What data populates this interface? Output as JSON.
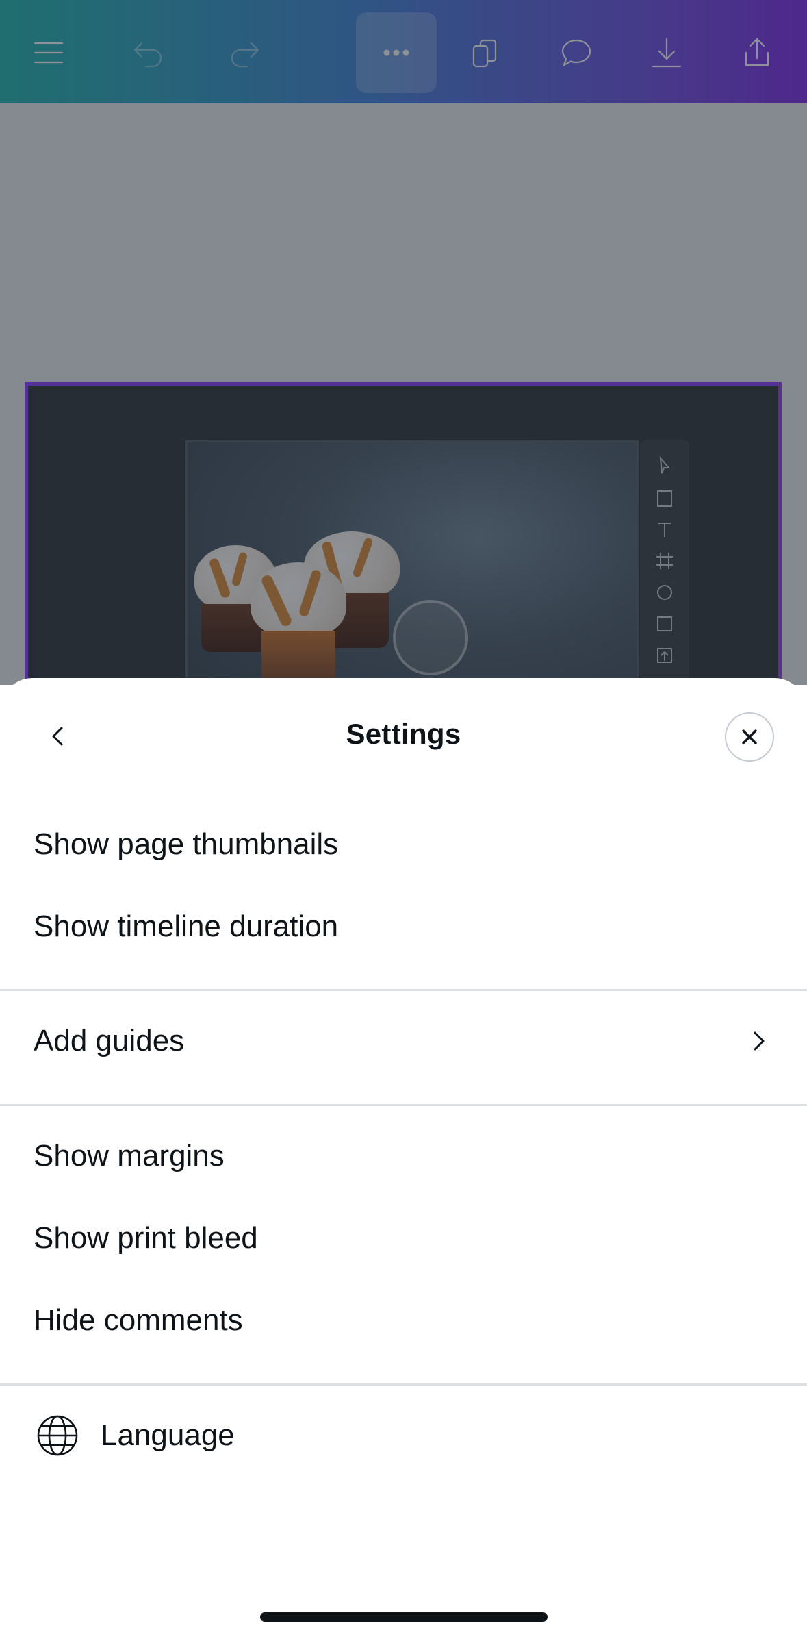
{
  "sheet": {
    "title": "Settings",
    "groups": [
      {
        "items": [
          {
            "label": "Show page thumbnails"
          },
          {
            "label": "Show timeline duration"
          }
        ]
      },
      {
        "items": [
          {
            "label": "Add guides",
            "has_chevron": true
          }
        ]
      },
      {
        "items": [
          {
            "label": "Show margins"
          },
          {
            "label": "Show print bleed"
          },
          {
            "label": "Hide comments"
          }
        ]
      },
      {
        "items": [
          {
            "label": "Language",
            "icon": "globe-icon"
          }
        ]
      }
    ]
  },
  "toolbar": {
    "icons": [
      "menu-icon",
      "undo-icon",
      "redo-icon",
      "more-icon",
      "pages-icon",
      "comment-icon",
      "download-icon",
      "share-icon"
    ]
  },
  "colors": {
    "accent": "#8b3dff",
    "toolbar_gradient_start": "#1fb8b0",
    "toolbar_gradient_end": "#7d2ae8"
  }
}
